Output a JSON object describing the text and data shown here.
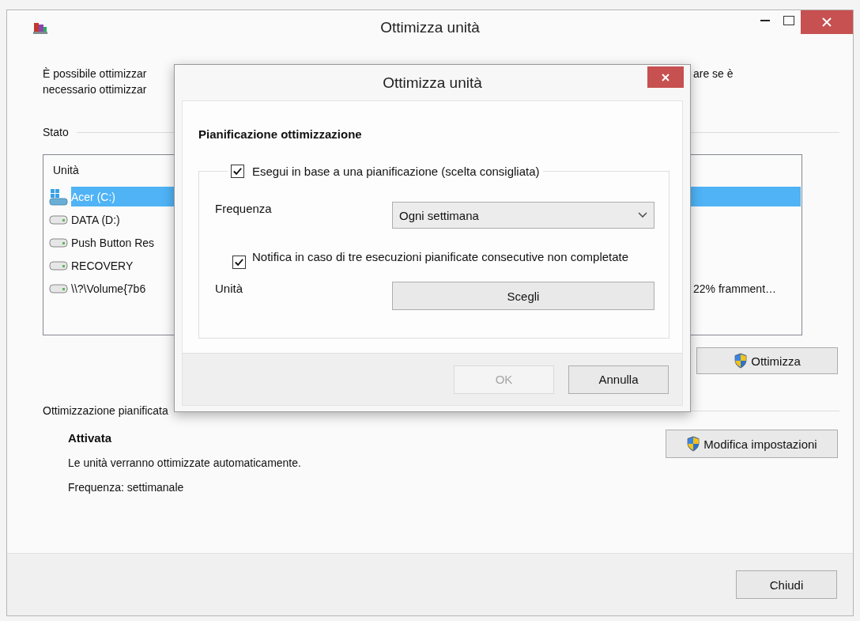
{
  "window": {
    "title": "Ottimizza unità"
  },
  "intro": {
    "left_line_1": "È possibile ottimizzar",
    "right_line_1": "are se è",
    "left_line_2": "necessario ottimizzar"
  },
  "status": {
    "label": "Stato",
    "table": {
      "columns": [
        "Unità"
      ],
      "rows": [
        {
          "kind": "system",
          "name": "Acer (C:)",
          "selected": true
        },
        {
          "kind": "drive",
          "name": "DATA (D:)",
          "selected": false
        },
        {
          "kind": "drive",
          "name": "Push Button Res",
          "selected": false
        },
        {
          "kind": "drive",
          "name": "RECOVERY",
          "selected": false
        },
        {
          "kind": "drive",
          "name": "\\\\?\\Volume{7b6",
          "column_3": "22% framment…",
          "selected": false
        }
      ]
    }
  },
  "optimize_button": "Ottimizza",
  "scheduled": {
    "label": "Ottimizzazione pianificata",
    "state": "Attivata",
    "description": "Le unità verranno ottimizzate automaticamente.",
    "frequency": "Frequenza: settimanale",
    "button": "Modifica impostazioni"
  },
  "close_button": "Chiudi",
  "dialog": {
    "title": "Ottimizza unità",
    "heading": "Pianificazione ottimizzazione",
    "schedule": {
      "label": "Esegui in base a una pianificazione (scelta consigliata)",
      "checked": true
    },
    "frequency": {
      "label": "Frequenza",
      "value": "Ogni settimana"
    },
    "notify": {
      "label": "Notifica in caso di tre esecuzioni pianificate consecutive non completate",
      "checked": true
    },
    "drives": {
      "label": "Unità",
      "button": "Scegli"
    },
    "buttons": [
      {
        "label": "OK",
        "disabled": true
      },
      {
        "label": "Annulla",
        "disabled": false
      }
    ]
  }
}
